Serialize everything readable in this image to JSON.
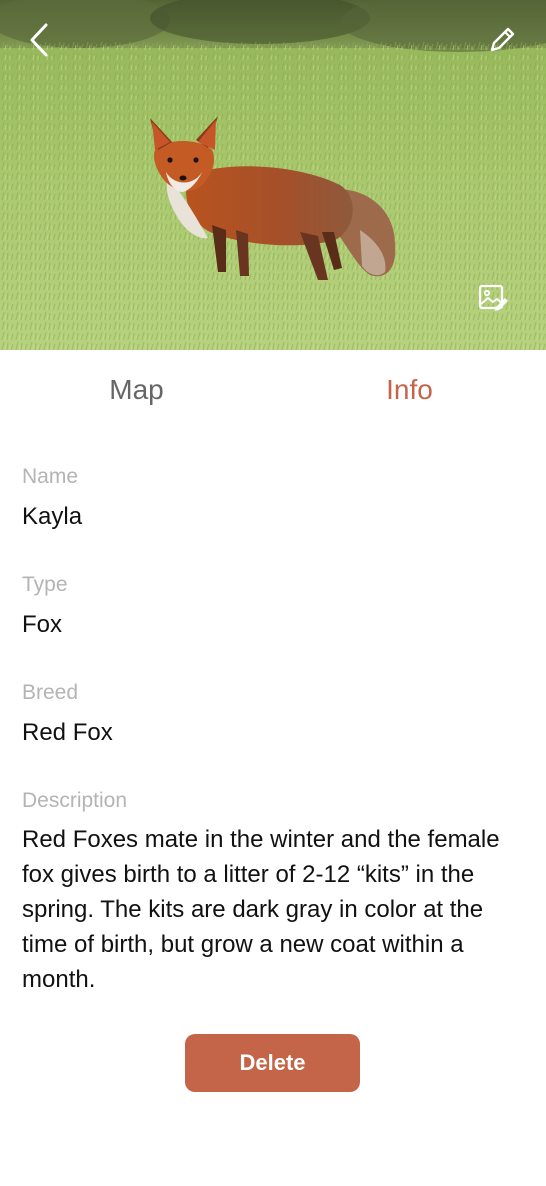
{
  "header": {
    "back_icon": "chevron-left-icon",
    "edit_icon": "pencil-icon",
    "photo_edit_icon": "image-edit-icon",
    "photo_subject": "red fox standing in a grassy field"
  },
  "tabs": [
    {
      "label": "Map",
      "active": false
    },
    {
      "label": "Info",
      "active": true
    }
  ],
  "fields": {
    "name": {
      "label": "Name",
      "value": "Kayla"
    },
    "type": {
      "label": "Type",
      "value": "Fox"
    },
    "breed": {
      "label": "Breed",
      "value": "Red Fox"
    },
    "description": {
      "label": "Description",
      "value": "Red Foxes mate in the winter and the female fox gives birth to a litter of 2-12 “kits” in the spring. The kits are dark gray in color at the time of birth, but grow a new coat within a month."
    }
  },
  "actions": {
    "delete_label": "Delete"
  },
  "colors": {
    "accent": "#c4654a",
    "label_gray": "#b4b4b4",
    "tab_inactive": "#666666"
  }
}
